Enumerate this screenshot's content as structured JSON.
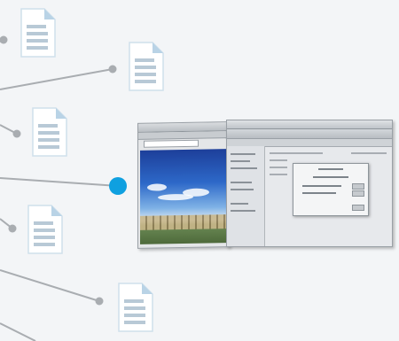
{
  "diagram": {
    "kind": "hub-and-spoke",
    "hub": {
      "color": "#0fa0e0",
      "icon": "hub-dot"
    },
    "connector_color": "#a9adb1",
    "document_icon": {
      "name": "document-icon",
      "fill": "#ffffff",
      "accent": "#b9d3e6",
      "lines": "#b8c9d6"
    },
    "documents": [
      {
        "id": "doc-1"
      },
      {
        "id": "doc-2"
      },
      {
        "id": "doc-3"
      },
      {
        "id": "doc-4"
      },
      {
        "id": "doc-5"
      }
    ],
    "screenshot": {
      "description_icon": "app-screenshot-thumbnail"
    }
  }
}
